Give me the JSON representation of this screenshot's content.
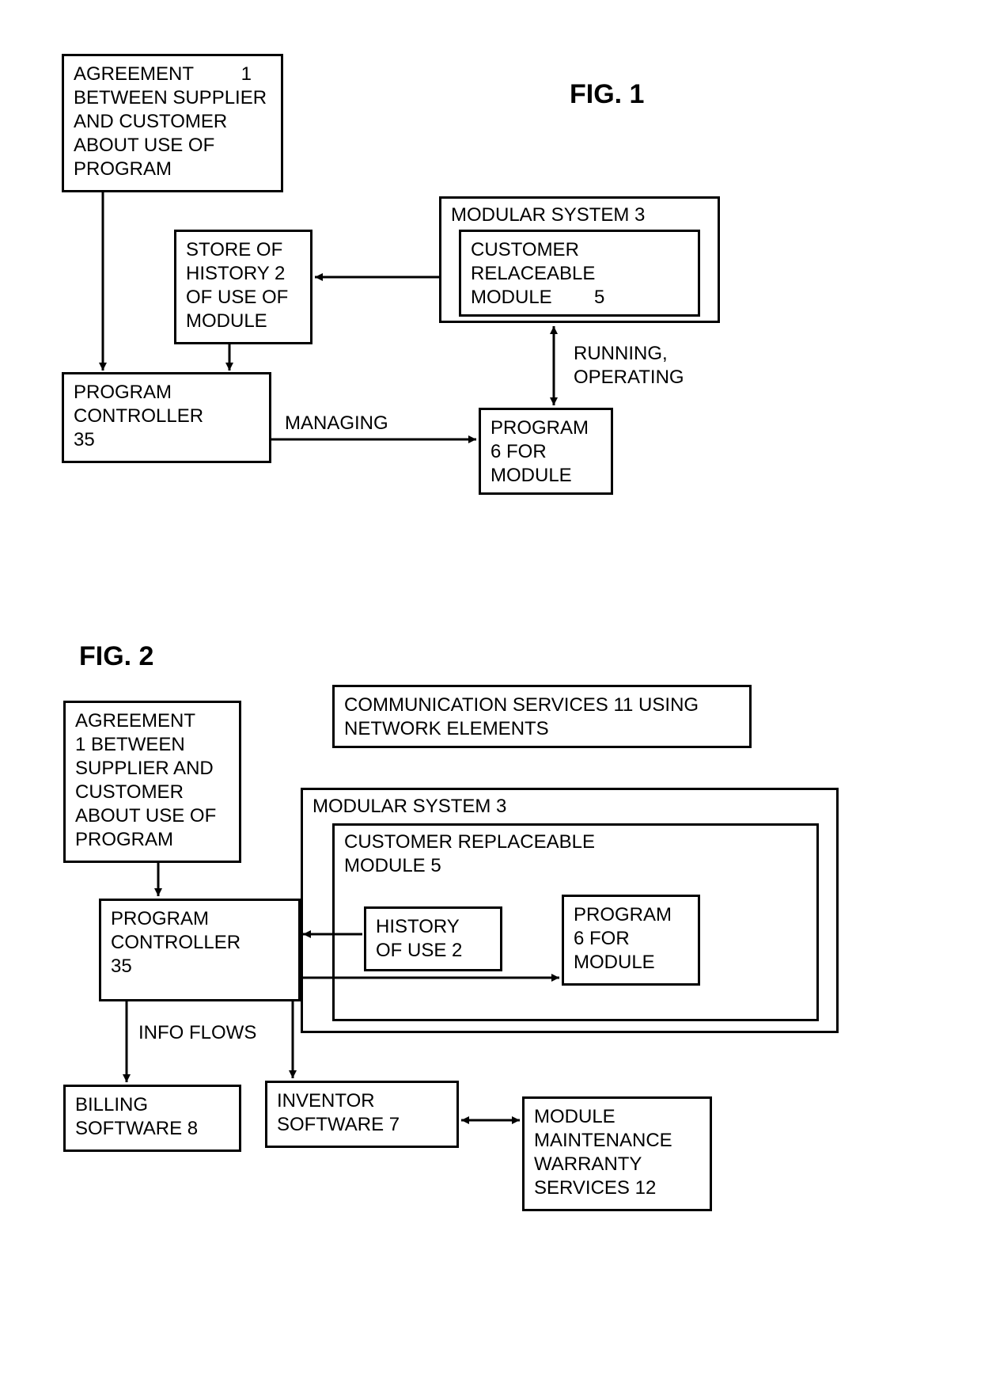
{
  "fig1": {
    "title": "FIG. 1",
    "boxes": {
      "agreement": "AGREEMENT         1\nBETWEEN SUPPLIER\nAND CUSTOMER\nABOUT USE OF\nPROGRAM",
      "store": "STORE OF\nHISTORY 2\nOF USE OF\nMODULE",
      "controller": "PROGRAM\nCONTROLLER\n35",
      "modular_label": "MODULAR SYSTEM 3",
      "crm": "CUSTOMER\nRELACEABLE\nMODULE        5",
      "program6": "PROGRAM\n6 FOR\nMODULE"
    },
    "labels": {
      "managing": "MANAGING",
      "running": "RUNNING,\nOPERATING"
    }
  },
  "fig2": {
    "title": "FIG. 2",
    "boxes": {
      "agreement": "AGREEMENT\n1 BETWEEN\nSUPPLIER AND\nCUSTOMER\nABOUT USE OF\nPROGRAM",
      "comm": "COMMUNICATION SERVICES 11 USING\nNETWORK ELEMENTS",
      "modular_label": "MODULAR SYSTEM 3",
      "crm_label": "CUSTOMER REPLACEABLE\nMODULE 5",
      "history": "HISTORY\nOF USE 2",
      "program6": "PROGRAM\n6 FOR\nMODULE",
      "controller": "PROGRAM\nCONTROLLER\n35",
      "billing": "BILLING\nSOFTWARE 8",
      "inventor": "INVENTOR\nSOFTWARE 7",
      "maint": "MODULE\nMAINTENANCE\nWARRANTY\nSERVICES 12"
    },
    "labels": {
      "infoflows": "INFO FLOWS"
    }
  }
}
